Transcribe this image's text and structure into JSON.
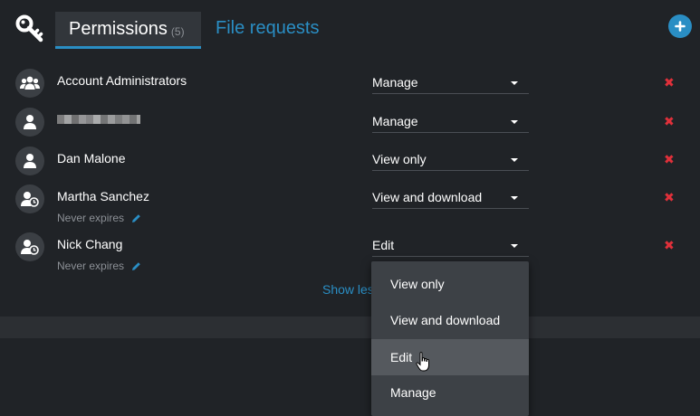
{
  "tabs": [
    {
      "label": "Permissions",
      "count": "(5)",
      "active": true
    },
    {
      "label": "File requests",
      "active": false
    }
  ],
  "icons": {
    "header": "key-icon",
    "add": "plus-icon",
    "group": "group-icon",
    "user": "user-icon",
    "user_expiry": "user-clock-icon",
    "remove": "close-icon",
    "edit": "pencil-icon"
  },
  "rows": [
    {
      "name": "Account Administrators",
      "permission": "Manage",
      "avatar": "group-icon"
    },
    {
      "name": "",
      "permission": "Manage",
      "avatar": "user-icon",
      "redacted": true
    },
    {
      "name": "Dan Malone",
      "permission": "View only",
      "avatar": "user-icon"
    },
    {
      "name": "Martha Sanchez",
      "permission": "View and download",
      "avatar": "user-clock-icon",
      "expires": "Never expires"
    },
    {
      "name": "Nick Chang",
      "permission": "Edit",
      "avatar": "user-clock-icon",
      "expires": "Never expires"
    }
  ],
  "show_less": "Show less",
  "remove_glyph": "✖",
  "dropdown": {
    "options": [
      "View only",
      "View and download",
      "Edit",
      "Manage"
    ],
    "highlighted": "Edit"
  },
  "colors": {
    "accent": "#2a8ec4",
    "danger": "#e0303a",
    "background": "#202327",
    "menu": "#3d4146"
  }
}
